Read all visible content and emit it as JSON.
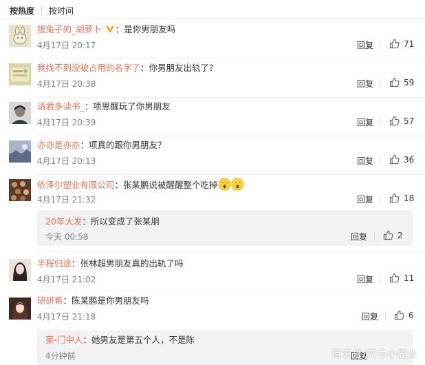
{
  "sort": {
    "hot": "按热度",
    "time": "按时间"
  },
  "reply_label": "回复",
  "comments": [
    {
      "user": "拔兔子的_胡萝卜",
      "sep": "：",
      "text": "是你男朋友吗",
      "time": "4月17日 20:17",
      "likes": "71"
    },
    {
      "user": "我找不到没被占用的名字了",
      "sep": "：",
      "text": "你男朋友出轨了？",
      "time": "4月17日 20:38",
      "likes": "59"
    },
    {
      "user": "请君多读书_",
      "sep": "：",
      "text": "项思醒玩了你男朋友",
      "time": "4月17日 20:39",
      "likes": "57"
    },
    {
      "user": "亦亦是亦亦",
      "sep": "：",
      "text": "项真的跟你男朋友？",
      "time": "4月17日 20:13",
      "likes": "36"
    },
    {
      "user": "依泽尔塑业有限公司",
      "sep": "：",
      "text": "张某鹏说被醒醒整个吃掉",
      "time": "4月17日 21:32",
      "likes": "18"
    },
    {
      "user": "半程归途",
      "sep": "：",
      "text": "张林超男朋友真的出轨了吗",
      "time": "4月17日 21:02",
      "likes": "11"
    },
    {
      "user": "研研希",
      "sep": "：",
      "text": "陈某鹏是你男朋友吗",
      "time": "4月17日 21:18",
      "likes": "6"
    }
  ],
  "subreplies": [
    {
      "user": "20年大发",
      "sep": "：",
      "text": "所以变成了张某朋",
      "time": "今天 00:58",
      "likes": "2"
    },
    {
      "user": "豪-门中人",
      "sep": "：",
      "text": "她男友是第五个人，不是陈",
      "time": "4分钟前",
      "likes": ""
    }
  ],
  "watermark": "百家号/天才小鹿龙",
  "colors": {
    "username": "#eb7350",
    "meta": "#808080",
    "subbox_bg": "#f2f2f5",
    "vip_badge": "#ffa200"
  },
  "icons": {
    "like": "thumbs-up-icon",
    "vip": "vip-badge-icon",
    "emoji": "yawn-emoji-icon"
  }
}
